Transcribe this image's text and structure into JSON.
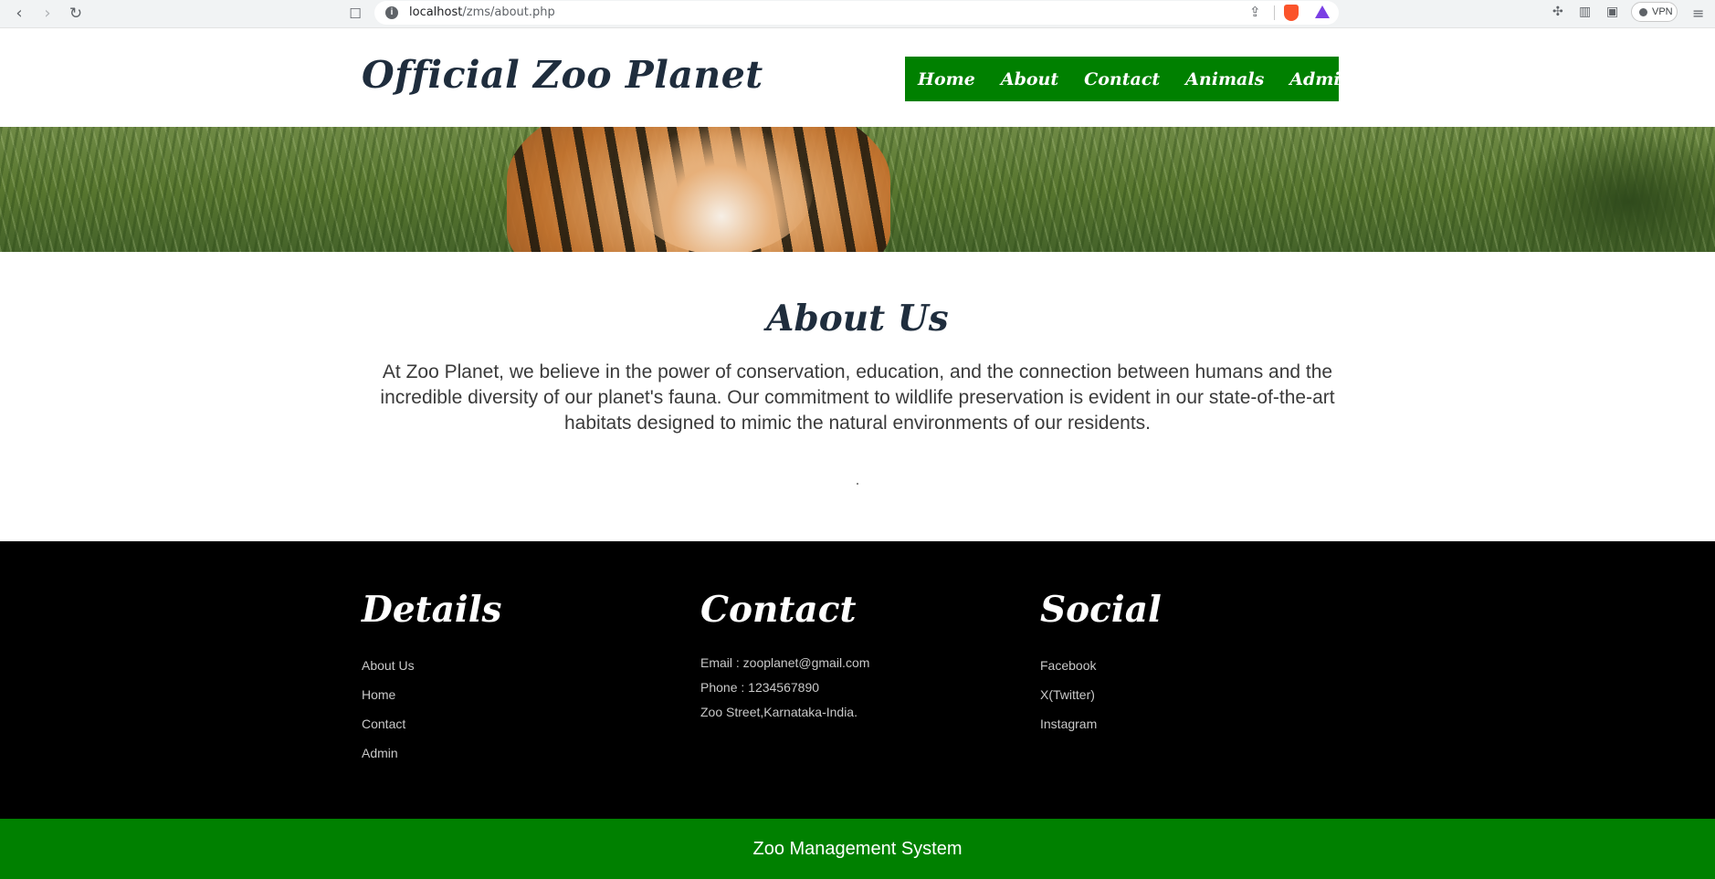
{
  "browser": {
    "url_host": "localhost",
    "url_path": "/zms/about.php",
    "vpn_label": "VPN"
  },
  "site": {
    "logo": "Official Zoo Planet",
    "nav": [
      "Home",
      "About",
      "Contact",
      "Animals",
      "Admin"
    ]
  },
  "about": {
    "title": "About Us",
    "text": "At Zoo Planet, we believe in the power of conservation, education, and the connection between humans and the incredible diversity of our planet's fauna. Our commitment to wildlife preservation is evident in our state-of-the-art habitats designed to mimic the natural environments of our residents."
  },
  "footer": {
    "details": {
      "title": "Details",
      "links": [
        "About Us",
        "Home",
        "Contact",
        "Admin"
      ]
    },
    "contact": {
      "title": "Contact",
      "email": "Email : zooplanet@gmail.com",
      "phone": "Phone : 1234567890",
      "address": "Zoo Street,Karnataka-India."
    },
    "social": {
      "title": "Social",
      "links": [
        "Facebook",
        "X(Twitter)",
        "Instagram"
      ]
    }
  },
  "bottom_bar": "Zoo Management System",
  "colors": {
    "nav_bg": "#008000",
    "heading": "#1f2d3d",
    "footer_bg": "#000000"
  }
}
